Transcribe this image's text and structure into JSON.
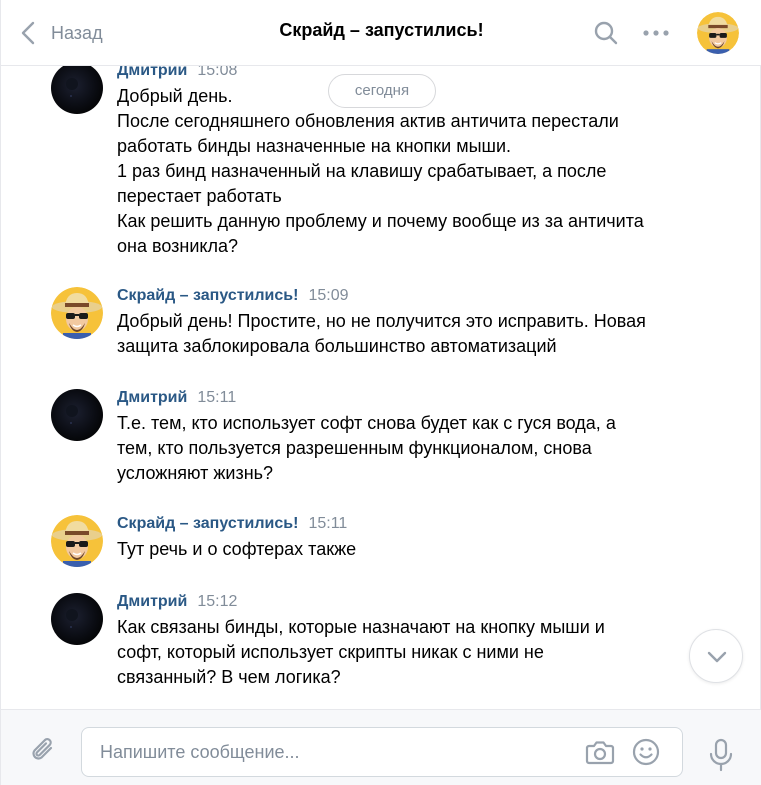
{
  "header": {
    "back_label": "Назад",
    "title": "Скрайд – запустились!",
    "icons": [
      "chevron-left-icon",
      "search-icon",
      "more-icon",
      "chat-avatar"
    ]
  },
  "date_divider": "сегодня",
  "messages": [
    {
      "author": "Дмитрий",
      "time": "15:08",
      "lines": [
        "Добрый день.",
        "После сегодняшнего обновления актив античита перестали",
        "работать бинды назначенные на кнопки мыши.",
        "1 раз бинд назначенный на клавишу срабатывает, а после",
        "перестает работать",
        "Как решить данную проблему и почему вообще из за античита",
        "она возникла?"
      ]
    },
    {
      "author": "Скрайд – запустились!",
      "time": "15:09",
      "lines": [
        "Добрый день! Простите, но не получится это исправить. Новая",
        "защита заблокировала большинство автоматизаций"
      ]
    },
    {
      "author": "Дмитрий",
      "time": "15:11",
      "lines": [
        "Т.е. тем, кто использует софт снова будет как с гуся вода, а",
        "тем, кто пользуется разрешенным функционалом, снова",
        "усложняют жизнь?"
      ]
    },
    {
      "author": "Скрайд – запустились!",
      "time": "15:11",
      "lines": [
        "Тут речь и о софтерах также"
      ]
    },
    {
      "author": "Дмитрий",
      "time": "15:12",
      "lines": [
        "Как связаны бинды, которые назначают на кнопку мыши и",
        "софт, который использует скрипты никак с ними не",
        "связанный? В чем логика?"
      ]
    }
  ],
  "composer": {
    "placeholder": "Напишите сообщение...",
    "value": "",
    "icons": [
      "paperclip-icon",
      "camera-icon",
      "smile-icon",
      "microphone-icon"
    ]
  },
  "colors": {
    "author": "#2a5885",
    "muted": "#818c99",
    "border": "#e7e8ec",
    "composer_bg": "#f7f8fa"
  }
}
